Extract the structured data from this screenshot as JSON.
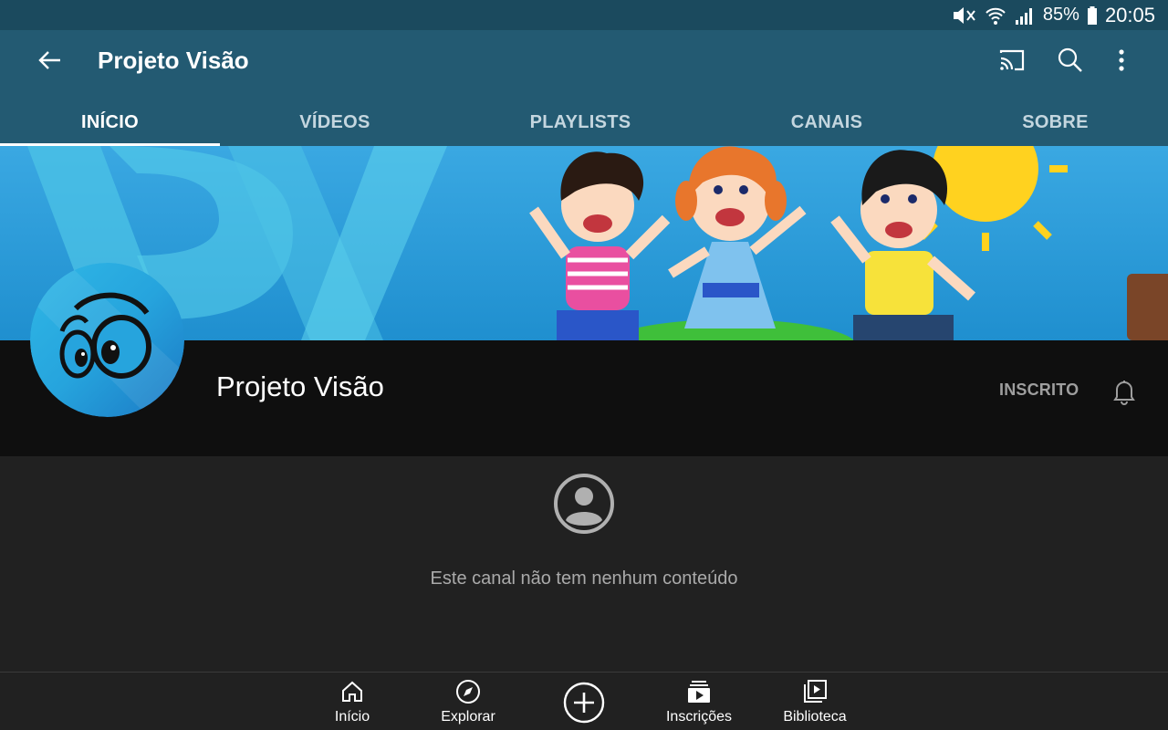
{
  "status_bar": {
    "battery": "85%",
    "time": "20:05",
    "icons": [
      "mute-icon",
      "wifi-icon",
      "signal-icon",
      "battery-icon"
    ]
  },
  "app_bar": {
    "title": "Projeto Visão",
    "actions": [
      "back-arrow-icon",
      "cast-icon",
      "search-icon",
      "more-vert-icon"
    ]
  },
  "tabs": [
    {
      "label": "INÍCIO",
      "active": true
    },
    {
      "label": "VÍDEOS",
      "active": false
    },
    {
      "label": "PLAYLISTS",
      "active": false
    },
    {
      "label": "CANAIS",
      "active": false
    },
    {
      "label": "SOBRE",
      "active": false
    }
  ],
  "channel": {
    "name": "Projeto Visão",
    "subscribe_label": "INSCRITO"
  },
  "empty_state": {
    "message": "Este canal não tem nenhum conteúdo",
    "icon": "account-circle-icon"
  },
  "bottom_nav": {
    "items": [
      {
        "label": "Início",
        "icon": "home-icon"
      },
      {
        "label": "Explorar",
        "icon": "compass-icon"
      },
      {
        "label": "Inscrições",
        "icon": "subscriptions-icon"
      },
      {
        "label": "Biblioteca",
        "icon": "library-icon"
      }
    ],
    "create_icon": "add-circle-icon"
  },
  "colors": {
    "status_bar": "#1b4a5e",
    "app_bar": "#235a72",
    "channel_header": "#0f0f0f",
    "content_bg": "#212121",
    "banner_sky": "#2e9fd9"
  }
}
